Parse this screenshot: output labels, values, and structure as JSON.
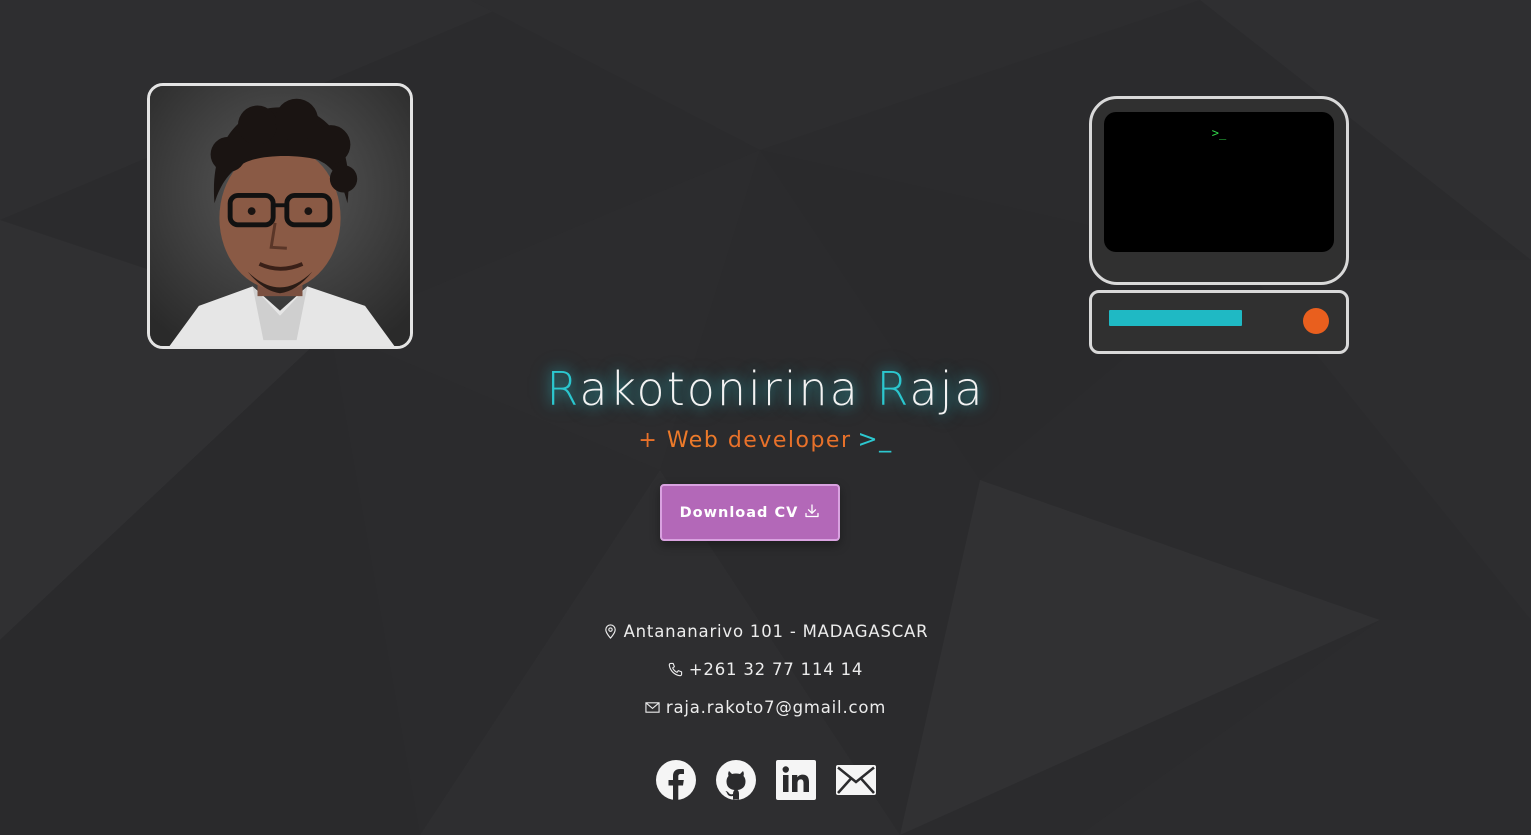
{
  "hero": {
    "name_initial_1": "R",
    "name_rest_1": "akotonirina",
    "name_initial_2": "R",
    "name_rest_2": "aja",
    "role_prefix": "+",
    "role_strong": "Web",
    "role_rest": "developer",
    "cursor": ">_"
  },
  "computer": {
    "screen_prompt": ">_"
  },
  "actions": {
    "download_label": "Download CV"
  },
  "contacts": {
    "address": "Antananarivo 101 - MADAGASCAR",
    "phone": "+261 32 77 114 14",
    "email": "raja.rakoto7@gmail.com"
  },
  "social": [
    {
      "icon": "facebook-icon"
    },
    {
      "icon": "github-icon"
    },
    {
      "icon": "linkedin-icon"
    },
    {
      "icon": "mail-icon"
    }
  ],
  "colors": {
    "background": "#2b2b2d",
    "accent_cyan": "#2cc7cf",
    "accent_orange": "#e8712a",
    "button": "#b368b8",
    "terminal_green": "#31d84a"
  }
}
